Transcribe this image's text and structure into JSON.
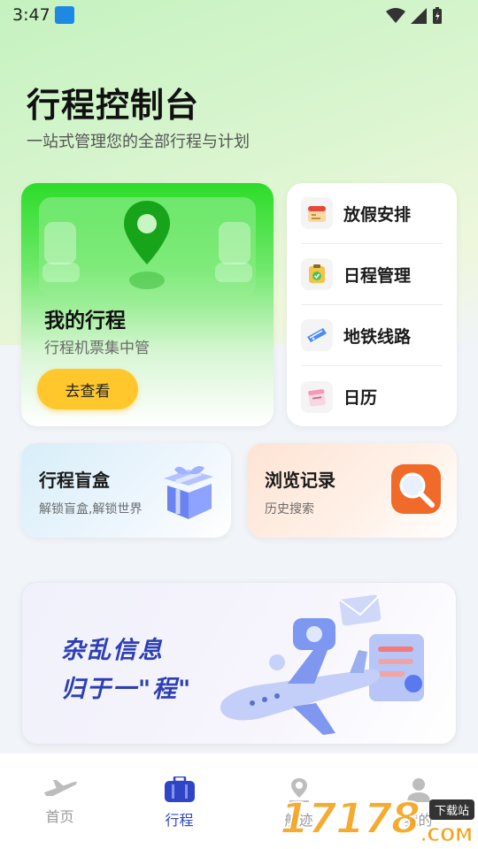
{
  "status_bar": {
    "time": "3:47"
  },
  "header": {
    "title": "行程控制台",
    "subtitle": "一站式管理您的全部行程与计划"
  },
  "trip_card": {
    "title": "我的行程",
    "subtitle": "行程机票集中管",
    "button": "去查看"
  },
  "quick_list": [
    {
      "label": "放假安排",
      "icon": "calendar-holiday-icon"
    },
    {
      "label": "日程管理",
      "icon": "schedule-clipboard-icon"
    },
    {
      "label": "地铁线路",
      "icon": "subway-ticket-icon"
    },
    {
      "label": "日历",
      "icon": "calendar-icon"
    }
  ],
  "blind_box": {
    "title": "行程盲盒",
    "subtitle": "解锁盲盒,解锁世界",
    "icon": "gift-box-icon"
  },
  "history": {
    "title": "浏览记录",
    "subtitle": "历史搜索",
    "icon": "magnifier-icon"
  },
  "banner": {
    "line1": "杂乱信息",
    "line2": "归于一\"程\""
  },
  "bottom_nav": [
    {
      "label": "首页",
      "icon": "airplane-icon",
      "active": false
    },
    {
      "label": "行程",
      "icon": "suitcase-icon",
      "active": true
    },
    {
      "label": "航迹",
      "icon": "route-pin-icon",
      "active": false
    },
    {
      "label": "我的",
      "icon": "profile-icon",
      "active": false
    }
  ],
  "watermark": {
    "digits": "17178",
    "tag": "下载站",
    "suffix": ".COM"
  },
  "colors": {
    "accent": "#2f45c6",
    "brand_green": "#2ddc2a",
    "button_yellow": "#ffc72c"
  }
}
